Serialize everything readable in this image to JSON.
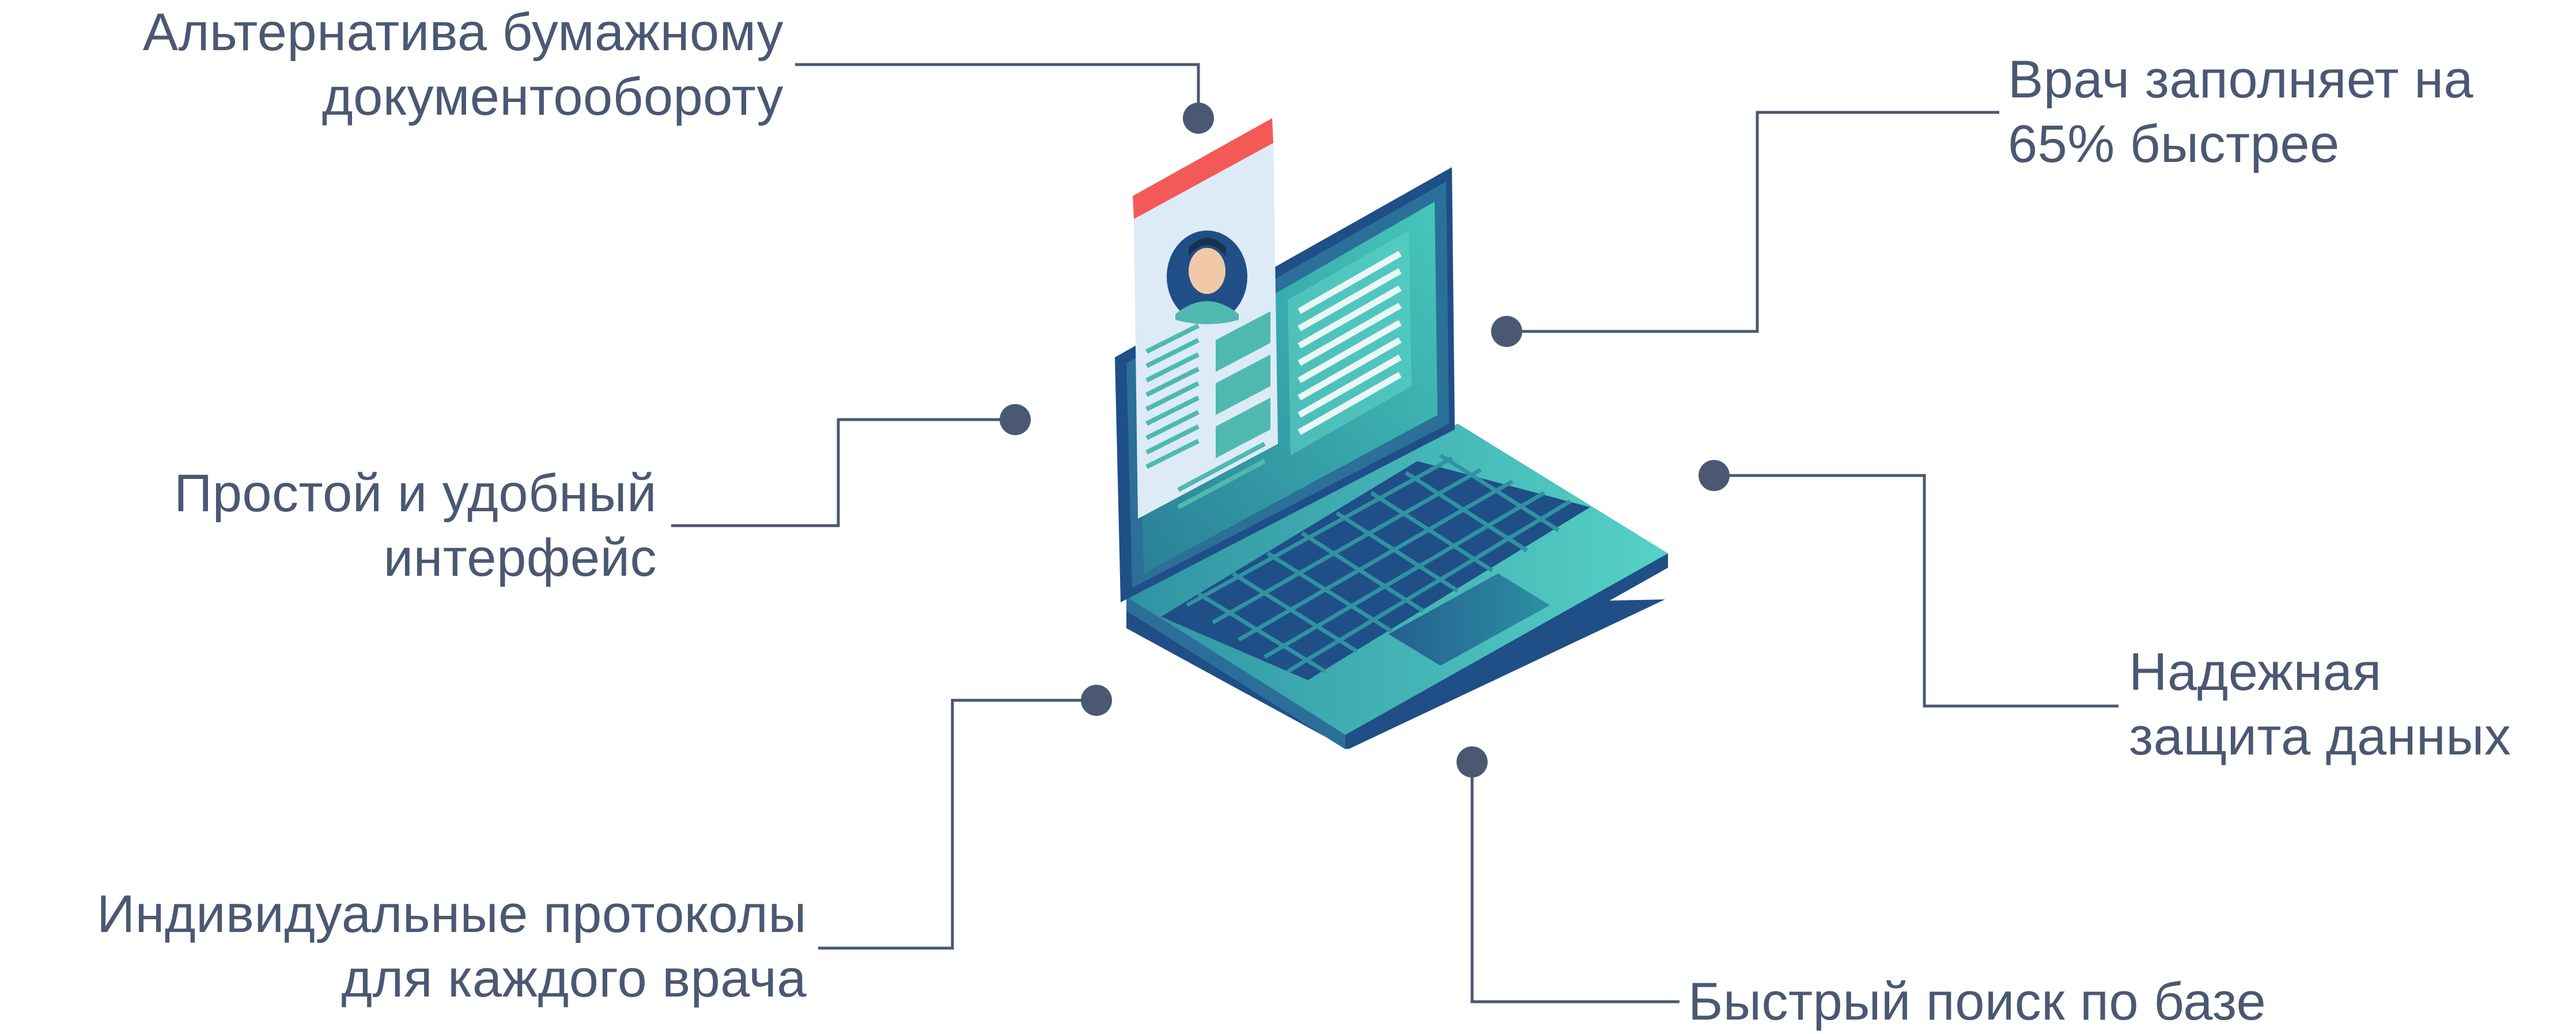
{
  "features": [
    {
      "id": "paperless",
      "lines": [
        "Альтернатива бумажному",
        "документообороту"
      ]
    },
    {
      "id": "faster",
      "lines": [
        "Врач заполняет на",
        "65% быстрее"
      ]
    },
    {
      "id": "interface",
      "lines": [
        "Простой и удобный",
        "интерфейс"
      ]
    },
    {
      "id": "security",
      "lines": [
        "Надежная",
        "защита данных"
      ]
    },
    {
      "id": "protocols",
      "lines": [
        "Индивидуальные протоколы",
        "для каждого врача"
      ]
    },
    {
      "id": "search",
      "lines": [
        "Быстрый поиск по базе"
      ]
    }
  ],
  "colors": {
    "text": "#4a5872",
    "connector": "#4a5872",
    "dot": "#4a5872",
    "laptop_teal": "#3fbfb3",
    "laptop_dark": "#1f4f86",
    "card_header": "#f35a57",
    "card_bg": "#dcebf6"
  },
  "icons": [
    "laptop-illustration",
    "patient-card-icon",
    "avatar-icon"
  ]
}
